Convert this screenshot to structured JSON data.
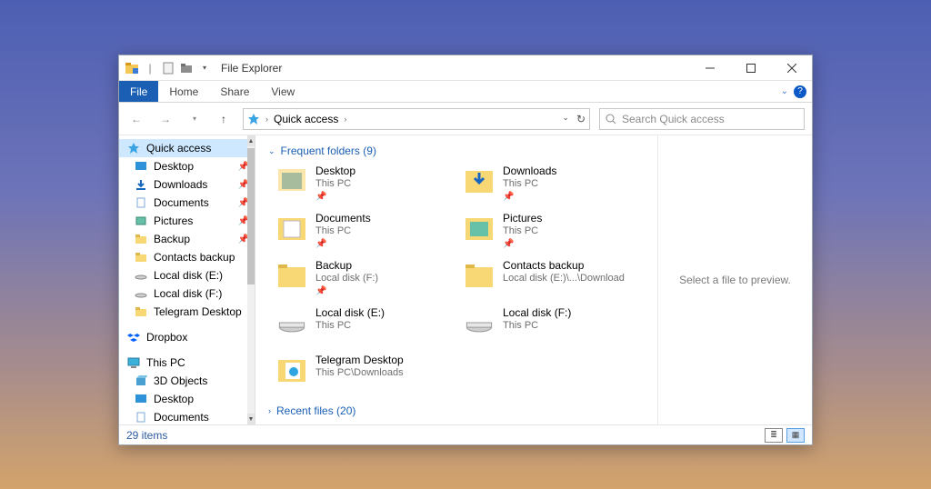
{
  "window": {
    "title": "File Explorer"
  },
  "ribbon": {
    "file": "File",
    "tabs": [
      "Home",
      "Share",
      "View"
    ]
  },
  "address": {
    "root_icon": "quick-access-star",
    "crumbs": [
      "Quick access"
    ]
  },
  "search": {
    "placeholder": "Search Quick access"
  },
  "nav": {
    "quick_access": "Quick access",
    "qa_items": [
      {
        "label": "Desktop",
        "icon": "desktop",
        "pinned": true
      },
      {
        "label": "Downloads",
        "icon": "downloads",
        "pinned": true
      },
      {
        "label": "Documents",
        "icon": "documents",
        "pinned": true
      },
      {
        "label": "Pictures",
        "icon": "pictures",
        "pinned": true
      },
      {
        "label": "Backup",
        "icon": "folder",
        "pinned": true
      },
      {
        "label": "Contacts backup",
        "icon": "folder",
        "pinned": false
      },
      {
        "label": "Local disk (E:)",
        "icon": "drive",
        "pinned": false
      },
      {
        "label": "Local disk (F:)",
        "icon": "drive",
        "pinned": false
      },
      {
        "label": "Telegram Desktop",
        "icon": "folder",
        "pinned": false
      }
    ],
    "dropbox": "Dropbox",
    "this_pc": "This PC",
    "pc_items": [
      {
        "label": "3D Objects",
        "icon": "3d"
      },
      {
        "label": "Desktop",
        "icon": "desktop"
      },
      {
        "label": "Documents",
        "icon": "documents"
      }
    ]
  },
  "groups": {
    "frequent": {
      "label": "Frequent folders",
      "count": 9
    },
    "recent": {
      "label": "Recent files",
      "count": 20
    }
  },
  "items": [
    {
      "name": "Desktop",
      "path": "This PC",
      "icon": "desktop",
      "pinned": true
    },
    {
      "name": "Downloads",
      "path": "This PC",
      "icon": "downloads",
      "pinned": true
    },
    {
      "name": "Documents",
      "path": "This PC",
      "icon": "documents",
      "pinned": true
    },
    {
      "name": "Pictures",
      "path": "This PC",
      "icon": "pictures",
      "pinned": true
    },
    {
      "name": "Backup",
      "path": "Local disk (F:)",
      "icon": "folder",
      "pinned": true
    },
    {
      "name": "Contacts backup",
      "path": "Local disk (E:)\\...\\Download",
      "icon": "folder",
      "pinned": false
    },
    {
      "name": "Local disk (E:)",
      "path": "This PC",
      "icon": "drive",
      "pinned": false
    },
    {
      "name": "Local disk (F:)",
      "path": "This PC",
      "icon": "drive",
      "pinned": false
    },
    {
      "name": "Telegram Desktop",
      "path": "This PC\\Downloads",
      "icon": "telegram",
      "pinned": false
    }
  ],
  "preview": {
    "empty": "Select a file to preview."
  },
  "status": {
    "count": "29 items"
  }
}
